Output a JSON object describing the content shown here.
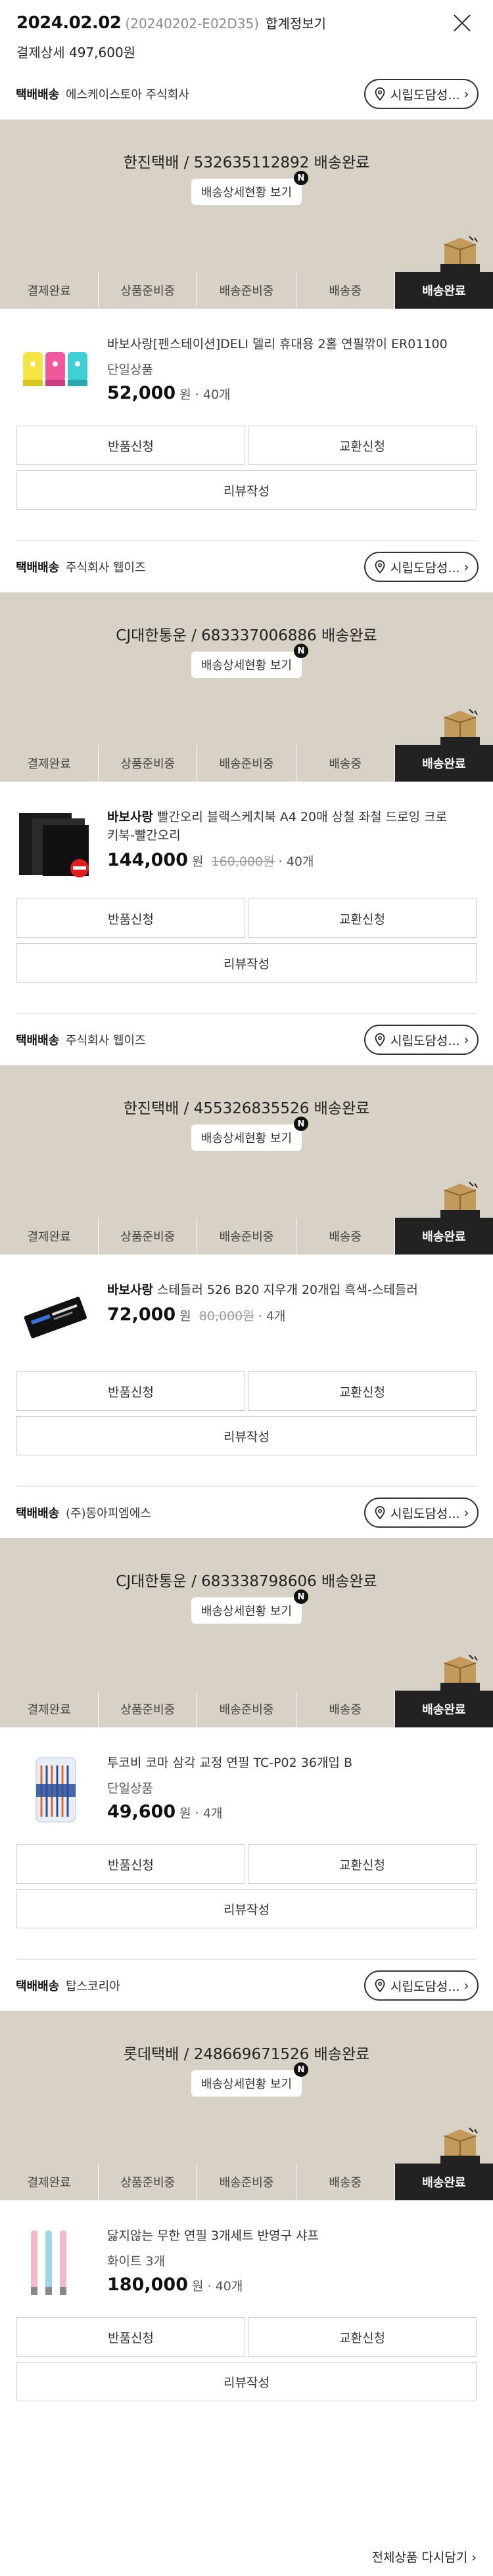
{
  "header": {
    "date": "2024.02.02",
    "order_no": "(20240202-E02D35)",
    "merge_link": "합계정보기",
    "pay_label": "결제상세",
    "pay_amount": "497,600원"
  },
  "labels": {
    "delivery_type": "택배배송",
    "address_search": "시립도담성...",
    "track_button": "배송상세현황 보기",
    "new_badge": "N",
    "return_button": "반품신청",
    "exchange_button": "교환신청",
    "review_button": "리뷰작성",
    "won": "원",
    "dot": "·",
    "steps": [
      "결제완료",
      "상품준비중",
      "배송준비중",
      "배송중",
      "배송완료"
    ]
  },
  "groups": [
    {
      "seller": "에스케이스토아 주식회사",
      "carrier": "한진택배 / 532635112892 배송완료",
      "product": {
        "brand": "",
        "name": "바보사랑[펜스테이션]DELI 델리 휴대용 2홀 연필깎이 ER01100",
        "option": "단일상품",
        "price": "52,000",
        "original": "",
        "qty": "40개"
      }
    },
    {
      "seller": "주식회사 웹이즈",
      "carrier": "CJ대한통운 / 683337006886 배송완료",
      "product": {
        "brand": "바보사랑",
        "name": "빨간오리 블랙스케치북 A4 20매 상철 좌철 드로잉 크로키북-빨간오리",
        "option": "",
        "price": "144,000",
        "original": "160,000원",
        "qty": "40개"
      }
    },
    {
      "seller": "주식회사 웹이즈",
      "carrier": "한진택배 / 455326835526 배송완료",
      "product": {
        "brand": "바보사랑",
        "name": "스테들러 526 B20 지우개 20개입 흑색-스테들러",
        "option": "",
        "price": "72,000",
        "original": "80,000원",
        "qty": "4개"
      }
    },
    {
      "seller": "(주)동아피엠에스",
      "carrier": "CJ대한통운 / 683338798606 배송완료",
      "product": {
        "brand": "",
        "name": "투코비 코마 삼각 교정 연필 TC-P02 36개입 B",
        "option": "단일상품",
        "price": "49,600",
        "original": "",
        "qty": "4개"
      }
    },
    {
      "seller": "탑스코리아",
      "carrier": "롯데택배 / 248669671526 배송완료",
      "product": {
        "brand": "",
        "name": "닳지않는 무한 연필 3개세트 반영구 샤프",
        "option": "화이트 3개",
        "price": "180,000",
        "original": "",
        "qty": "40개"
      }
    }
  ],
  "footer": {
    "reorder_link": "전체상품 다시담기 ›"
  },
  "colors": {
    "status_bg": "#d7d2c5",
    "active_step": "#222222"
  },
  "icons": [
    "close-icon",
    "location-pin-icon",
    "chevron-right-icon",
    "delivery-box-icon"
  ]
}
